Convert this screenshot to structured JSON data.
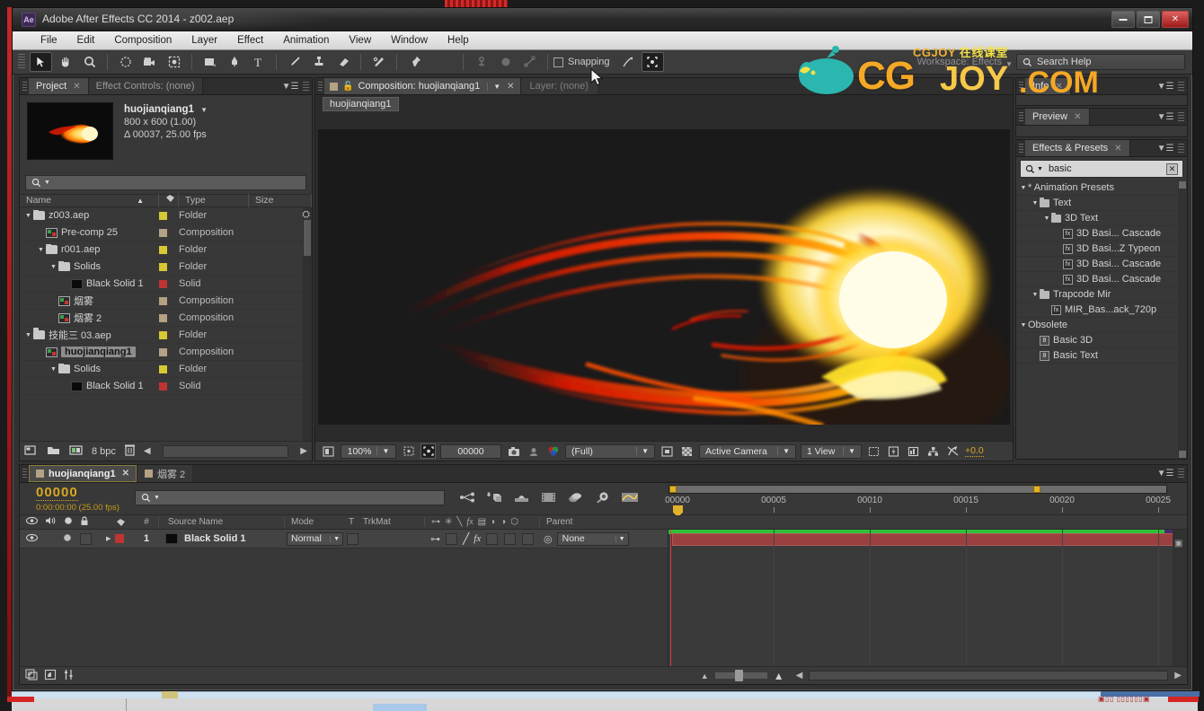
{
  "window": {
    "title": "Adobe After Effects CC 2014 - z002.aep",
    "app_badge": "Ae",
    "minimize": "–",
    "maximize": "□",
    "close": "✕"
  },
  "menubar": {
    "items": [
      "File",
      "Edit",
      "Composition",
      "Layer",
      "Effect",
      "Animation",
      "View",
      "Window",
      "Help"
    ]
  },
  "toolbar": {
    "snapping_label": "Snapping",
    "workspace_label": "Workspace:",
    "workspace_value": "Effects",
    "search_help_placeholder": "Search Help",
    "tools": [
      {
        "name": "selection-tool",
        "glyph": "➤"
      },
      {
        "name": "hand-tool",
        "glyph": "✋"
      },
      {
        "name": "zoom-tool",
        "glyph": "⌕"
      },
      {
        "name": "rotation-tool",
        "glyph": "↻"
      },
      {
        "name": "camera-tool",
        "glyph": "📷"
      },
      {
        "name": "pan-behind-tool",
        "glyph": "⬚"
      },
      {
        "name": "shape-tool",
        "glyph": "■"
      },
      {
        "name": "pen-tool",
        "glyph": "✒"
      },
      {
        "name": "type-tool",
        "glyph": "T"
      },
      {
        "name": "brush-tool",
        "glyph": "╱"
      },
      {
        "name": "clone-stamp-tool",
        "glyph": "⚙"
      },
      {
        "name": "eraser-tool",
        "glyph": "▰"
      },
      {
        "name": "roto-brush-tool",
        "glyph": "✒"
      },
      {
        "name": "puppet-pin-tool",
        "glyph": "📌"
      }
    ]
  },
  "watermark": {
    "top_line_a": "CGJOY",
    "top_line_b": "在线课堂",
    "cg": "CG",
    "joy": "JOY",
    "dotcom": ".COM"
  },
  "project_panel": {
    "tabs": [
      {
        "label": "Project",
        "active": true,
        "close": "✕"
      },
      {
        "label": "Effect Controls: (none)",
        "active": false
      }
    ],
    "comp_info": {
      "name": "huojianqiang1",
      "dimensions": "800 x 600 (1.00)",
      "duration": "Δ 00037, 25.00 fps"
    },
    "search_placeholder": "",
    "columns": [
      "Name",
      "Type",
      "Size"
    ],
    "items": [
      {
        "label": "z003.aep",
        "type": "Folder",
        "kind": "folder",
        "indent": 0,
        "twirl": "▼",
        "swatch": "#d8c832",
        "selected": false
      },
      {
        "label": "Pre-comp 25",
        "type": "Composition",
        "kind": "comp",
        "indent": 1,
        "twirl": "",
        "swatch": "#b5a183",
        "selected": false
      },
      {
        "label": "r001.aep",
        "type": "Folder",
        "kind": "folder",
        "indent": 1,
        "twirl": "▼",
        "swatch": "#d8c832",
        "selected": false
      },
      {
        "label": "Solids",
        "type": "Folder",
        "kind": "folder",
        "indent": 2,
        "twirl": "▼",
        "swatch": "#d8c832",
        "selected": false
      },
      {
        "label": "Black Solid 1",
        "type": "Solid",
        "kind": "solid",
        "indent": 3,
        "twirl": "",
        "swatch": "#c03434",
        "selected": false
      },
      {
        "label": "烟雾",
        "type": "Composition",
        "kind": "comp",
        "indent": 2,
        "twirl": "",
        "swatch": "#b5a183",
        "selected": false
      },
      {
        "label": "烟雾 2",
        "type": "Composition",
        "kind": "comp",
        "indent": 2,
        "twirl": "",
        "swatch": "#b5a183",
        "selected": false
      },
      {
        "label": "技能三 03.aep",
        "type": "Folder",
        "kind": "folder",
        "indent": 0,
        "twirl": "▼",
        "swatch": "#d8c832",
        "selected": false
      },
      {
        "label": "huojianqiang1",
        "type": "Composition",
        "kind": "comp",
        "indent": 1,
        "twirl": "",
        "swatch": "#b5a183",
        "selected": true
      },
      {
        "label": "Solids",
        "type": "Folder",
        "kind": "folder",
        "indent": 2,
        "twirl": "▼",
        "swatch": "#d8c832",
        "selected": false
      },
      {
        "label": "Black Solid 1",
        "type": "Solid",
        "kind": "solid",
        "indent": 3,
        "twirl": "",
        "swatch": "#c03434",
        "selected": false
      }
    ],
    "footer": {
      "bit_depth": "8 bpc"
    }
  },
  "comp_panel": {
    "tab_composition": "Composition: huojianqiang1",
    "tab_layer": "Layer: (none)",
    "breadcrumb": "huojianqiang1",
    "footer": {
      "zoom": "100%",
      "timecode": "00000",
      "resolution": "(Full)",
      "camera": "Active Camera",
      "views": "1 View",
      "exposure": "+0.0"
    }
  },
  "right_column": {
    "info_tab": "Info",
    "preview_tab": "Preview",
    "effects_tab": "Effects & Presets",
    "search_value": "basic",
    "clear_glyph": "✕",
    "tree": [
      {
        "label": "* Animation Presets",
        "indent": 0,
        "twirl": "▼",
        "icon": "none"
      },
      {
        "label": "Text",
        "indent": 1,
        "twirl": "▼",
        "icon": "folder"
      },
      {
        "label": "3D Text",
        "indent": 2,
        "twirl": "▼",
        "icon": "folder"
      },
      {
        "label": "3D Basi... Cascade",
        "indent": 3,
        "twirl": "",
        "icon": "preset"
      },
      {
        "label": "3D Basi...Z Typeon",
        "indent": 3,
        "twirl": "",
        "icon": "preset"
      },
      {
        "label": "3D Basi... Cascade",
        "indent": 3,
        "twirl": "",
        "icon": "preset"
      },
      {
        "label": "3D Basi... Cascade",
        "indent": 3,
        "twirl": "",
        "icon": "preset"
      },
      {
        "label": "Trapcode Mir",
        "indent": 1,
        "twirl": "▼",
        "icon": "folder"
      },
      {
        "label": "MIR_Bas...ack_720p",
        "indent": 2,
        "twirl": "",
        "icon": "preset"
      },
      {
        "label": "Obsolete",
        "indent": 0,
        "twirl": "▼",
        "icon": "none"
      },
      {
        "label": "Basic 3D",
        "indent": 1,
        "twirl": "",
        "icon": "fx"
      },
      {
        "label": "Basic Text",
        "indent": 1,
        "twirl": "",
        "icon": "fx"
      }
    ]
  },
  "timeline": {
    "tabs": [
      {
        "label": "huojianqiang1",
        "active": true,
        "close": "✕"
      },
      {
        "label": "烟雾 2",
        "active": false
      }
    ],
    "current_time_frames": "00000",
    "current_time_code": "0:00:00:00 (25.00 fps)",
    "search_placeholder": "",
    "columns": [
      "#",
      "Source Name",
      "Mode",
      "T",
      "TrkMat",
      "Parent"
    ],
    "ruler_labels": [
      "00000",
      "00005",
      "00010",
      "00015",
      "00020",
      "00025"
    ],
    "layers": [
      {
        "index": "1",
        "source_name": "Black Solid 1",
        "mode": "Normal",
        "parent": "None",
        "label_color": "#c03434",
        "solid_color": "#0a0a0a"
      }
    ]
  },
  "colors": {
    "accent_orange": "#d8a820",
    "panel_bg": "#383838",
    "layer_bar": "#9b4040",
    "work_area": "#e2b32a",
    "cti_red": "#e03a3a",
    "green_bar": "#2fbf3a"
  }
}
